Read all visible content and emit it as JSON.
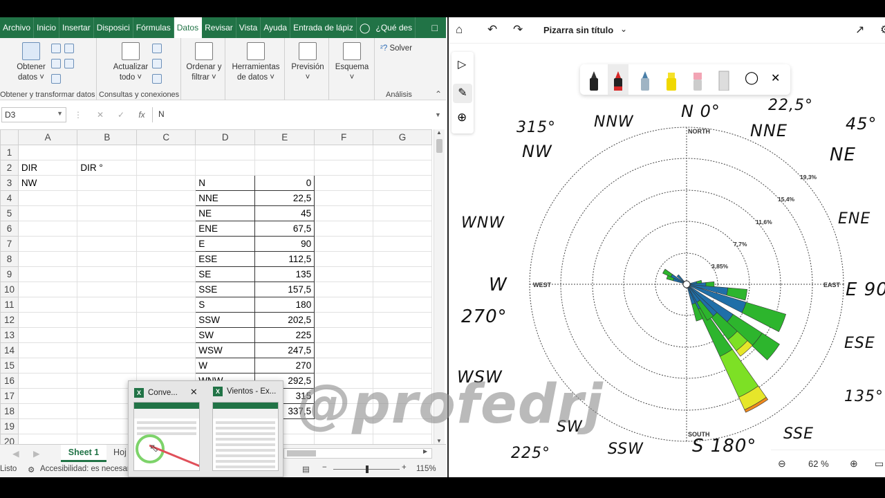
{
  "excel": {
    "ribbon_tabs": [
      "Archivo",
      "Inicio",
      "Insertar",
      "Disposici",
      "Fórmulas",
      "Datos",
      "Revisar",
      "Vista",
      "Ayuda",
      "Entrada de lápiz"
    ],
    "tell_me": "¿Qué des",
    "ribbon": {
      "obtener_l1": "Obtener",
      "obtener_l2": "datos ˅",
      "actualizar_l1": "Actualizar",
      "actualizar_l2": "todo ˅",
      "ordenar_l1": "Ordenar y",
      "ordenar_l2": "filtrar ˅",
      "herr_l1": "Herramientas",
      "herr_l2": "de datos ˅",
      "prevision": "Previsión",
      "esquema": "Esquema",
      "solver": "Solver",
      "group_obtener": "Obtener y transformar datos",
      "group_consultas": "Consultas y conexiones",
      "group_analisis": "Análisis"
    },
    "name_box": "D3",
    "formula_value": "N",
    "columns": [
      "A",
      "B",
      "C",
      "D",
      "E",
      "F",
      "G"
    ],
    "rows": [
      {
        "n": "1",
        "a": "",
        "b": "",
        "d": "",
        "e": ""
      },
      {
        "n": "2",
        "a": "DIR",
        "b": "DIR °",
        "d": "",
        "e": ""
      },
      {
        "n": "3",
        "a": "NW",
        "b": "",
        "d": "N",
        "e": "0"
      },
      {
        "n": "4",
        "a": "",
        "b": "",
        "d": "NNE",
        "e": "22,5"
      },
      {
        "n": "5",
        "a": "",
        "b": "",
        "d": "NE",
        "e": "45"
      },
      {
        "n": "6",
        "a": "",
        "b": "",
        "d": "ENE",
        "e": "67,5"
      },
      {
        "n": "7",
        "a": "",
        "b": "",
        "d": "E",
        "e": "90"
      },
      {
        "n": "8",
        "a": "",
        "b": "",
        "d": "ESE",
        "e": "112,5"
      },
      {
        "n": "9",
        "a": "",
        "b": "",
        "d": "SE",
        "e": "135"
      },
      {
        "n": "10",
        "a": "",
        "b": "",
        "d": "SSE",
        "e": "157,5"
      },
      {
        "n": "11",
        "a": "",
        "b": "",
        "d": "S",
        "e": "180"
      },
      {
        "n": "12",
        "a": "",
        "b": "",
        "d": "SSW",
        "e": "202,5"
      },
      {
        "n": "13",
        "a": "",
        "b": "",
        "d": "SW",
        "e": "225"
      },
      {
        "n": "14",
        "a": "",
        "b": "",
        "d": "WSW",
        "e": "247,5"
      },
      {
        "n": "15",
        "a": "",
        "b": "",
        "d": "W",
        "e": "270"
      },
      {
        "n": "16",
        "a": "",
        "b": "",
        "d": "WNW",
        "e": "292,5"
      },
      {
        "n": "17",
        "a": "",
        "b": "",
        "d": "",
        "e": "315"
      },
      {
        "n": "18",
        "a": "",
        "b": "",
        "d": "",
        "e": "337,5"
      },
      {
        "n": "19",
        "a": "",
        "b": "",
        "d": "",
        "e": ""
      },
      {
        "n": "20",
        "a": "",
        "b": "",
        "d": "",
        "e": ""
      }
    ],
    "sheet_tab": "Sheet 1",
    "sheet_tab2": "Hoj",
    "status_ready": "Listo",
    "status_access": "Accesibilidad: es necesario",
    "zoom": "115%",
    "thumb1": "Conve...",
    "thumb2": "Vientos - Ex..."
  },
  "whiteboard": {
    "title": "Pizarra sin título",
    "zoom": "62 %",
    "rose": {
      "cardinals": {
        "north": "NORTH",
        "south": "SOUTH",
        "east": "EAST",
        "west": "WEST"
      },
      "rings": [
        "3,85%",
        "7,7%",
        "11,6%",
        "15,4%",
        "19,3%"
      ],
      "colors": {
        "dark": "#1f6fa8",
        "green": "#2db52d",
        "lime": "#7de025",
        "yellow": "#e6e62a",
        "orange": "#f08a1e"
      }
    },
    "handwriting": [
      "315°",
      "NW",
      "NNW",
      "N 0°",
      "22,5°",
      "NNE",
      "45°",
      "NE",
      "WNW",
      "ENE",
      "W",
      "270°",
      "E 90",
      "ESE",
      "WSW",
      "135°",
      "SW",
      "SSW",
      "S 180°",
      "SSE",
      "225°"
    ],
    "watermark": "@profedrj"
  }
}
